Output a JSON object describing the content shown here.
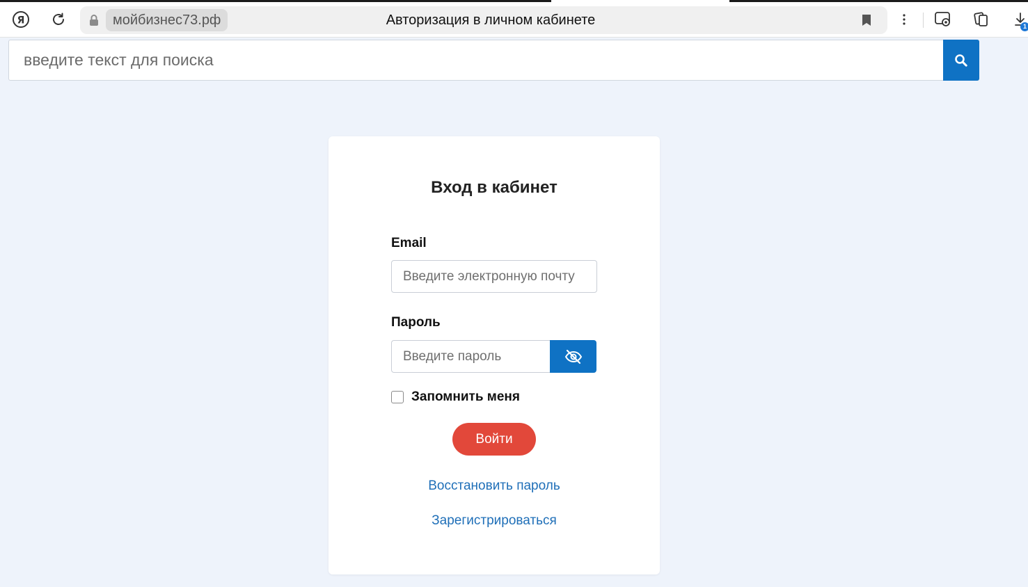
{
  "browser": {
    "domain": "мойбизнес73.рф",
    "page_title": "Авторизация в личном кабинете",
    "download_badge": "1"
  },
  "search": {
    "placeholder": "введите текст для поиска"
  },
  "login": {
    "title": "Вход в кабинет",
    "email_label": "Email",
    "email_placeholder": "Введите электронную почту",
    "password_label": "Пароль",
    "password_placeholder": "Введите пароль",
    "remember_label": "Запомнить меня",
    "submit_label": "Войти",
    "restore_link": "Восстановить пароль",
    "register_link": "Зарегистрироваться"
  },
  "icons": {
    "yandex": "yandex-logo-icon",
    "reload": "reload-icon",
    "lock": "lock-icon",
    "bookmark": "bookmark-icon",
    "menu": "more-vertical-icon",
    "screenshot": "screenshot-icon",
    "cards": "cards-icon",
    "download": "download-icon",
    "search": "search-icon",
    "eye": "eye-off-icon"
  },
  "colors": {
    "accent": "#0f72c4",
    "submit": "#e2483a",
    "link": "#1f6fb8",
    "background": "#eef3fb"
  }
}
